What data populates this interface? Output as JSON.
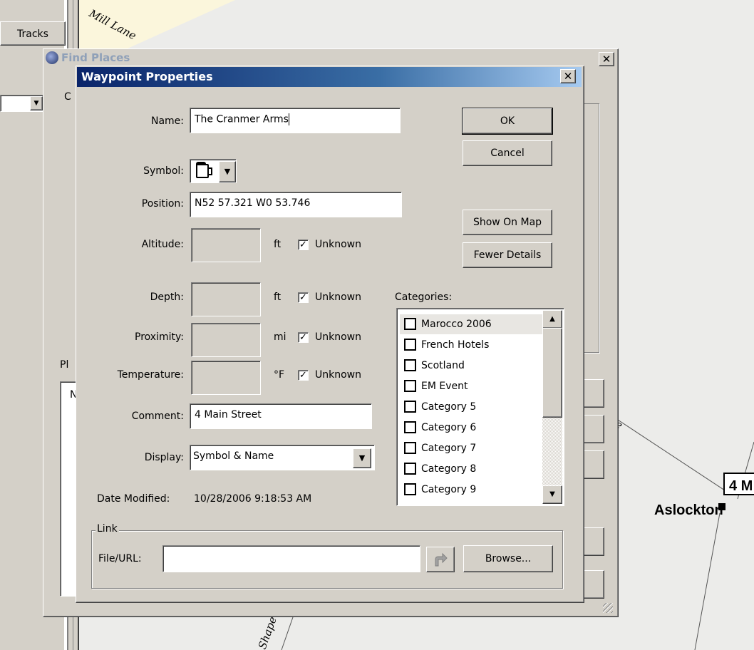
{
  "background": {
    "tracks_tab": "Tracks",
    "roads": [
      "Mill Lane",
      "Shape",
      "e"
    ],
    "place_name": "Aslockton",
    "map_marker": "4 M"
  },
  "find_places": {
    "title": "Find Places",
    "tab_stub": "C",
    "places_stub": "Pl",
    "header_stub": "N"
  },
  "dialog": {
    "title": "Waypoint Properties",
    "fields": {
      "name_label": "Name:",
      "name_value": "The Cranmer Arms",
      "symbol_label": "Symbol:",
      "symbol_icon": "beer-mug-icon",
      "position_label": "Position:",
      "position_value": "N52 57.321 W0 53.746",
      "altitude_label": "Altitude:",
      "depth_label": "Depth:",
      "proximity_label": "Proximity:",
      "temperature_label": "Temperature:",
      "comment_label": "Comment:",
      "comment_value": "4 Main Street",
      "display_label": "Display:",
      "display_value": "Symbol & Name",
      "date_modified_label": "Date Modified:",
      "date_modified_value": "10/28/2006 9:18:53 AM"
    },
    "units": {
      "altitude": "ft",
      "depth": "ft",
      "proximity": "mi",
      "temperature": "°F"
    },
    "unknown_label": "Unknown",
    "buttons": {
      "ok": "OK",
      "cancel": "Cancel",
      "show_on_map": "Show On Map",
      "fewer_details": "Fewer Details",
      "browse": "Browse..."
    },
    "categories_label": "Categories:",
    "categories": [
      "Marocco 2006",
      "French Hotels",
      "Scotland",
      "EM Event",
      "Category 5",
      "Category 6",
      "Category 7",
      "Category 8",
      "Category 9"
    ],
    "link": {
      "group_label": "Link",
      "file_url_label": "File/URL:",
      "file_url_value": ""
    }
  },
  "colors": {
    "window_bg": "#d4d0c8",
    "title_gradient_start": "#0a246a",
    "title_gradient_end": "#a6caf0",
    "map_bg": "#ececea",
    "road_fill": "#fbf6dc"
  }
}
